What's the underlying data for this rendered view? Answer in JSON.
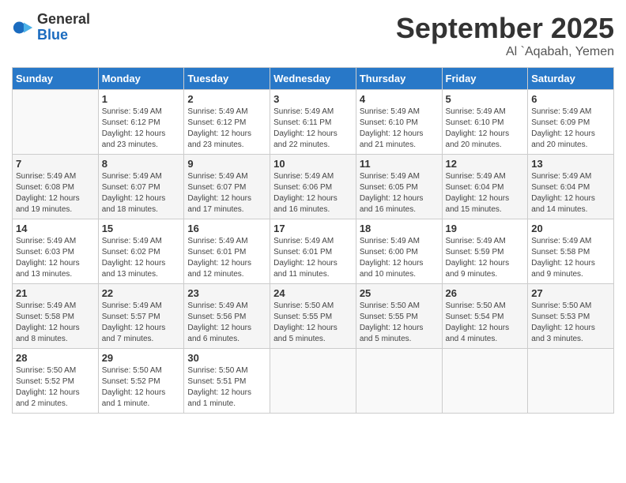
{
  "header": {
    "logo_general": "General",
    "logo_blue": "Blue",
    "month": "September 2025",
    "location": "Al `Aqabah, Yemen"
  },
  "weekdays": [
    "Sunday",
    "Monday",
    "Tuesday",
    "Wednesday",
    "Thursday",
    "Friday",
    "Saturday"
  ],
  "weeks": [
    [
      {
        "day": "",
        "info": ""
      },
      {
        "day": "1",
        "info": "Sunrise: 5:49 AM\nSunset: 6:12 PM\nDaylight: 12 hours\nand 23 minutes."
      },
      {
        "day": "2",
        "info": "Sunrise: 5:49 AM\nSunset: 6:12 PM\nDaylight: 12 hours\nand 23 minutes."
      },
      {
        "day": "3",
        "info": "Sunrise: 5:49 AM\nSunset: 6:11 PM\nDaylight: 12 hours\nand 22 minutes."
      },
      {
        "day": "4",
        "info": "Sunrise: 5:49 AM\nSunset: 6:10 PM\nDaylight: 12 hours\nand 21 minutes."
      },
      {
        "day": "5",
        "info": "Sunrise: 5:49 AM\nSunset: 6:10 PM\nDaylight: 12 hours\nand 20 minutes."
      },
      {
        "day": "6",
        "info": "Sunrise: 5:49 AM\nSunset: 6:09 PM\nDaylight: 12 hours\nand 20 minutes."
      }
    ],
    [
      {
        "day": "7",
        "info": "Sunrise: 5:49 AM\nSunset: 6:08 PM\nDaylight: 12 hours\nand 19 minutes."
      },
      {
        "day": "8",
        "info": "Sunrise: 5:49 AM\nSunset: 6:07 PM\nDaylight: 12 hours\nand 18 minutes."
      },
      {
        "day": "9",
        "info": "Sunrise: 5:49 AM\nSunset: 6:07 PM\nDaylight: 12 hours\nand 17 minutes."
      },
      {
        "day": "10",
        "info": "Sunrise: 5:49 AM\nSunset: 6:06 PM\nDaylight: 12 hours\nand 16 minutes."
      },
      {
        "day": "11",
        "info": "Sunrise: 5:49 AM\nSunset: 6:05 PM\nDaylight: 12 hours\nand 16 minutes."
      },
      {
        "day": "12",
        "info": "Sunrise: 5:49 AM\nSunset: 6:04 PM\nDaylight: 12 hours\nand 15 minutes."
      },
      {
        "day": "13",
        "info": "Sunrise: 5:49 AM\nSunset: 6:04 PM\nDaylight: 12 hours\nand 14 minutes."
      }
    ],
    [
      {
        "day": "14",
        "info": "Sunrise: 5:49 AM\nSunset: 6:03 PM\nDaylight: 12 hours\nand 13 minutes."
      },
      {
        "day": "15",
        "info": "Sunrise: 5:49 AM\nSunset: 6:02 PM\nDaylight: 12 hours\nand 13 minutes."
      },
      {
        "day": "16",
        "info": "Sunrise: 5:49 AM\nSunset: 6:01 PM\nDaylight: 12 hours\nand 12 minutes."
      },
      {
        "day": "17",
        "info": "Sunrise: 5:49 AM\nSunset: 6:01 PM\nDaylight: 12 hours\nand 11 minutes."
      },
      {
        "day": "18",
        "info": "Sunrise: 5:49 AM\nSunset: 6:00 PM\nDaylight: 12 hours\nand 10 minutes."
      },
      {
        "day": "19",
        "info": "Sunrise: 5:49 AM\nSunset: 5:59 PM\nDaylight: 12 hours\nand 9 minutes."
      },
      {
        "day": "20",
        "info": "Sunrise: 5:49 AM\nSunset: 5:58 PM\nDaylight: 12 hours\nand 9 minutes."
      }
    ],
    [
      {
        "day": "21",
        "info": "Sunrise: 5:49 AM\nSunset: 5:58 PM\nDaylight: 12 hours\nand 8 minutes."
      },
      {
        "day": "22",
        "info": "Sunrise: 5:49 AM\nSunset: 5:57 PM\nDaylight: 12 hours\nand 7 minutes."
      },
      {
        "day": "23",
        "info": "Sunrise: 5:49 AM\nSunset: 5:56 PM\nDaylight: 12 hours\nand 6 minutes."
      },
      {
        "day": "24",
        "info": "Sunrise: 5:50 AM\nSunset: 5:55 PM\nDaylight: 12 hours\nand 5 minutes."
      },
      {
        "day": "25",
        "info": "Sunrise: 5:50 AM\nSunset: 5:55 PM\nDaylight: 12 hours\nand 5 minutes."
      },
      {
        "day": "26",
        "info": "Sunrise: 5:50 AM\nSunset: 5:54 PM\nDaylight: 12 hours\nand 4 minutes."
      },
      {
        "day": "27",
        "info": "Sunrise: 5:50 AM\nSunset: 5:53 PM\nDaylight: 12 hours\nand 3 minutes."
      }
    ],
    [
      {
        "day": "28",
        "info": "Sunrise: 5:50 AM\nSunset: 5:52 PM\nDaylight: 12 hours\nand 2 minutes."
      },
      {
        "day": "29",
        "info": "Sunrise: 5:50 AM\nSunset: 5:52 PM\nDaylight: 12 hours\nand 1 minute."
      },
      {
        "day": "30",
        "info": "Sunrise: 5:50 AM\nSunset: 5:51 PM\nDaylight: 12 hours\nand 1 minute."
      },
      {
        "day": "",
        "info": ""
      },
      {
        "day": "",
        "info": ""
      },
      {
        "day": "",
        "info": ""
      },
      {
        "day": "",
        "info": ""
      }
    ]
  ]
}
